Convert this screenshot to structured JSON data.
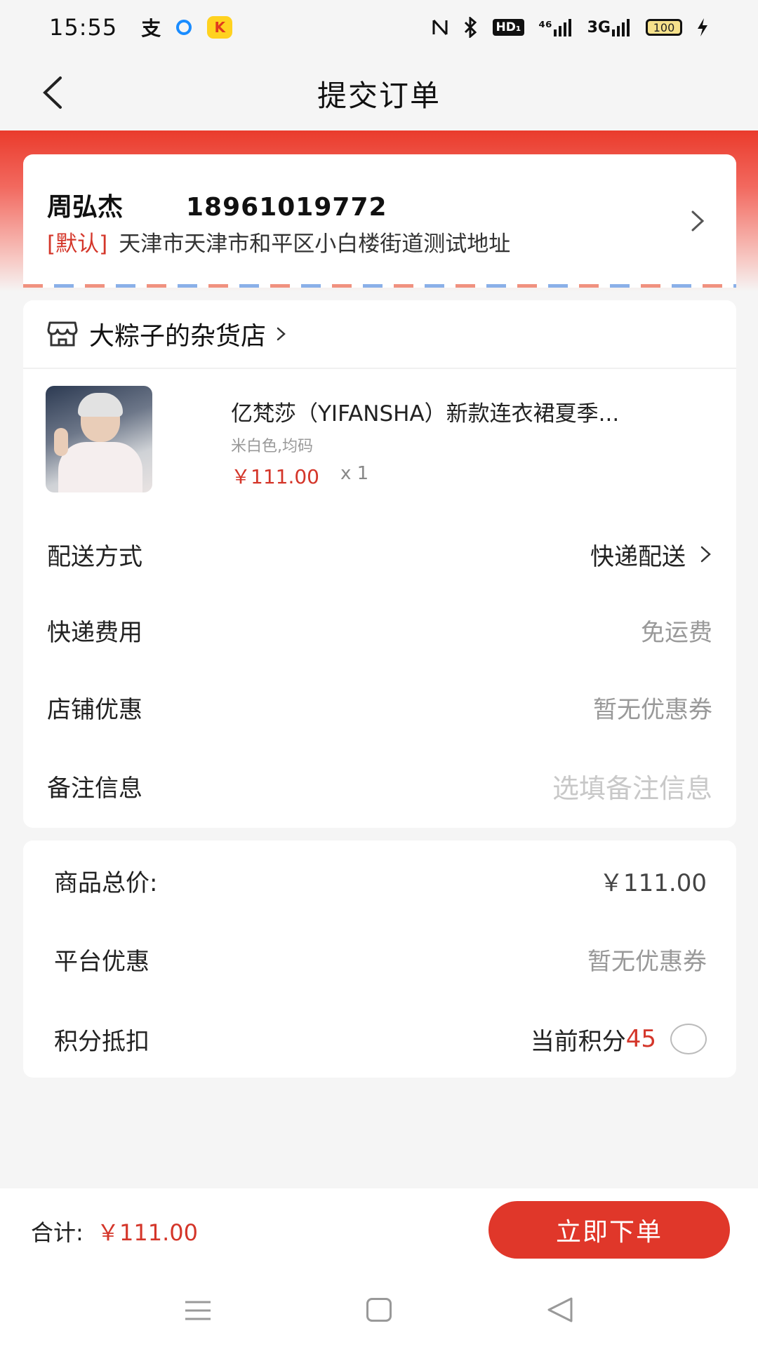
{
  "status_bar": {
    "time": "15:55",
    "signal_4g": "⁴⁶",
    "signal_3g": "3G",
    "hd_label": "HD₁",
    "battery": "100"
  },
  "header": {
    "title": "提交订单"
  },
  "address": {
    "name": "周弘杰",
    "phone": "18961019772",
    "tag": "[默认]",
    "detail": "天津市天津市和平区小白楼街道测试地址"
  },
  "shop": {
    "name": "大粽子的杂货店",
    "chevron": "›"
  },
  "product": {
    "title": "亿梵莎（YIFANSHA）新款连衣裙夏季...",
    "spec": "米白色,均码",
    "price": "￥111.00",
    "quantity": "x 1"
  },
  "order_options": {
    "delivery_label": "配送方式",
    "delivery_value": "快递配送",
    "shipping_label": "快递费用",
    "shipping_value": "免运费",
    "shop_discount_label": "店铺优惠",
    "shop_discount_value": "暂无优惠券",
    "note_label": "备注信息",
    "note_placeholder": "选填备注信息"
  },
  "summary": {
    "goods_total_label": "商品总价:",
    "goods_total_value": "￥111.00",
    "platform_discount_label": "平台优惠",
    "platform_discount_value": "暂无优惠券",
    "points_label": "积分抵扣",
    "points_current_label": "当前积分",
    "points_value": "45"
  },
  "footer": {
    "total_label": "合计:",
    "total_amount": "￥111.00",
    "submit_label": "立即下单"
  },
  "colors": {
    "accent_red": "#e0372a",
    "price_red": "#d4362a"
  }
}
